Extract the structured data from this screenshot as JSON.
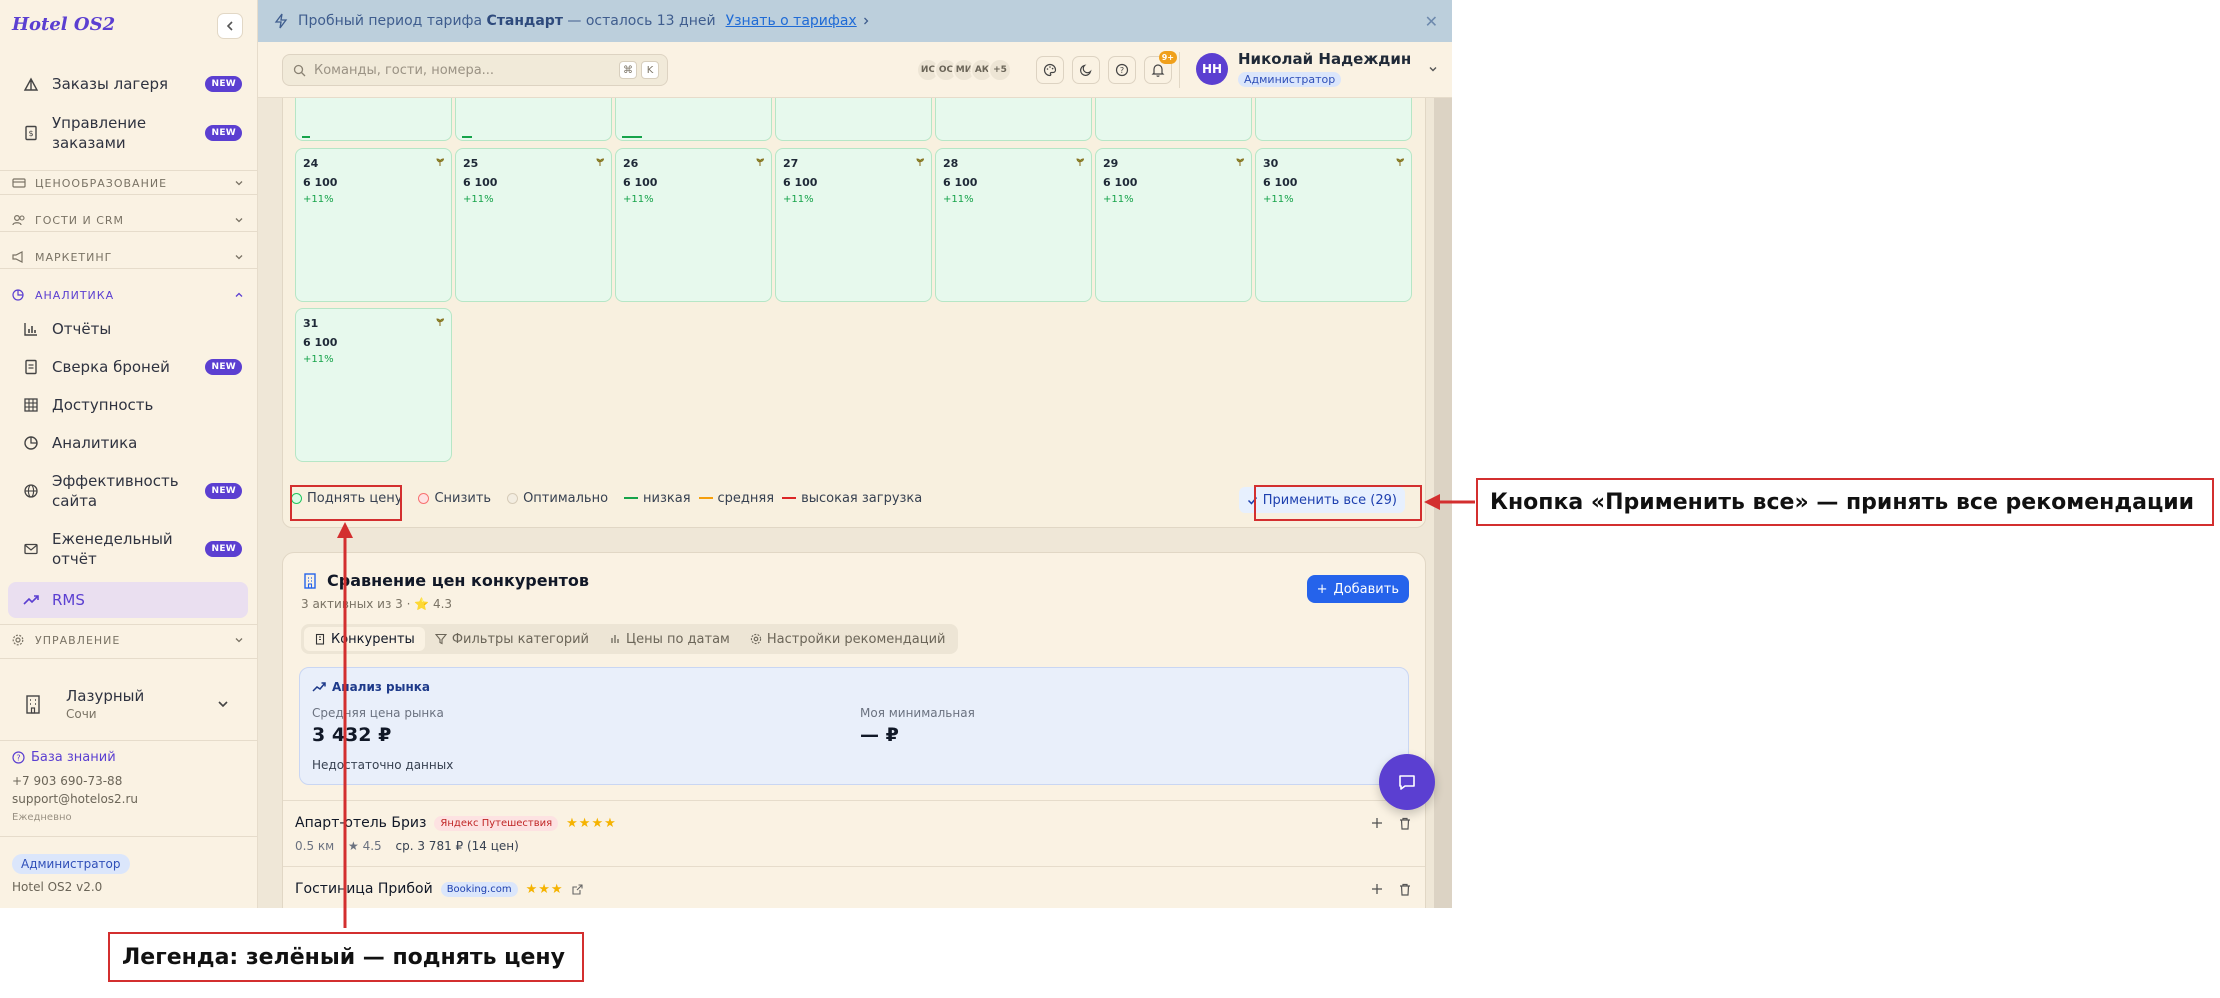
{
  "app": {
    "logo": "Hotel OS2"
  },
  "sidebar": {
    "items_top": [
      {
        "label": "Заказы лагеря",
        "badge": "NEW",
        "icon": "tent-icon"
      },
      {
        "label": "Управление заказами",
        "badge": "NEW",
        "icon": "receipt-icon"
      }
    ],
    "sections": {
      "pricing": "ЦЕНООБРАЗОВАНИЕ",
      "guests": "ГОСТИ И CRM",
      "marketing": "МАРКЕТИНГ",
      "analytics": "АНАЛИТИКА",
      "management": "УПРАВЛЕНИЕ"
    },
    "analytics_items": [
      {
        "label": "Отчёты",
        "badge": "",
        "icon": "bar-chart-icon"
      },
      {
        "label": "Сверка броней",
        "badge": "NEW",
        "icon": "document-icon"
      },
      {
        "label": "Доступность",
        "badge": "",
        "icon": "grid-icon"
      },
      {
        "label": "Аналитика",
        "badge": "",
        "icon": "clock-chart-icon"
      },
      {
        "label": "Эффективность сайта",
        "badge": "NEW",
        "icon": "globe-icon"
      },
      {
        "label": "Еженедельный отчёт",
        "badge": "NEW",
        "icon": "mail-icon"
      },
      {
        "label": "RMS",
        "badge": "",
        "icon": "trend-up-icon"
      }
    ],
    "hotel": {
      "name": "Лазурный",
      "city": "Сочи"
    },
    "footer": {
      "knowledge_base": "База знаний",
      "phone": "+7 903 690-73-88",
      "email": "support@hotelos2.ru",
      "schedule": "Ежедневно",
      "role": "Администратор",
      "version": "Hotel OS2 v2.0"
    }
  },
  "banner": {
    "prefix": "Пробный период тарифа",
    "plan": "Стандарт",
    "suffix": "— осталось 13 дней",
    "link": "Узнать о тарифах"
  },
  "header": {
    "search_placeholder": "Команды, гости, номера...",
    "kbd": [
      "⌘",
      "K"
    ],
    "presence": [
      "ИС",
      "ОС",
      "МИ",
      "АК",
      "+5"
    ],
    "notifications_count": "9+",
    "user": {
      "initials": "НН",
      "name": "Николай Надеждин",
      "role": "Администратор"
    }
  },
  "calendar": {
    "days": [
      {
        "day": "24",
        "price": "6 100",
        "change": "+11%"
      },
      {
        "day": "25",
        "price": "6 100",
        "change": "+11%"
      },
      {
        "day": "26",
        "price": "6 100",
        "change": "+11%"
      },
      {
        "day": "27",
        "price": "6 100",
        "change": "+11%"
      },
      {
        "day": "28",
        "price": "6 100",
        "change": "+11%"
      },
      {
        "day": "29",
        "price": "6 100",
        "change": "+11%"
      },
      {
        "day": "30",
        "price": "6 100",
        "change": "+11%"
      },
      {
        "day": "31",
        "price": "6 100",
        "change": "+11%"
      }
    ],
    "legend": {
      "raise": "Поднять цену",
      "lower": "Снизить",
      "optimal": "Оптимально",
      "low": "низкая",
      "medium": "средняя",
      "high": "высокая загрузка"
    },
    "apply_all": "Применить все (29)"
  },
  "competitors": {
    "title": "Сравнение цен конкурентов",
    "subtitle": "3 активных из 3 · ⭐ 4.3",
    "add_label": "Добавить",
    "tabs": [
      "Конкуренты",
      "Фильтры категорий",
      "Цены по датам",
      "Настройки рекомендаций"
    ],
    "market": {
      "title": "Анализ рынка",
      "avg_label": "Средняя цена рынка",
      "avg_value": "3 432 ₽",
      "min_label": "Моя минимальная",
      "min_value": "— ₽",
      "note": "Недостаточно данных"
    },
    "rows": [
      {
        "name": "Апарт-отель Бриз",
        "source": "Яндекс Путешествия",
        "stars": "★★★★",
        "distance": "0.5 км",
        "rating": "★ 4.5",
        "avg": "ср. 3 781 ₽ (14 цен)"
      },
      {
        "name": "Гостиница Прибой",
        "source": "Booking.com",
        "stars": "★★★"
      }
    ]
  },
  "annotations": {
    "apply_all": "Кнопка «Применить все» — принять все рекомендации",
    "legend": "Легенда: зелёный — поднять цену"
  },
  "colors": {
    "brand": "#5b3fd1",
    "primary_button": "#2563eb",
    "raise_green": "#16a34a",
    "medium_orange": "#f59e0b",
    "high_red": "#dc2626",
    "annotation_red": "#d32f2f"
  }
}
